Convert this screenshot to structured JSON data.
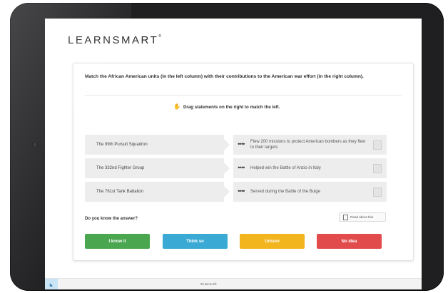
{
  "brand": {
    "name": "LEARNSMART",
    "mark": "®"
  },
  "question": {
    "text": "Match the African American units (in the left column) with their contributions to the American war effort (in the right column).",
    "instruction": "Drag statements on the right to match the left."
  },
  "match_pairs": [
    {
      "left": "The 99th Pursuit Squadron",
      "right": "Flew 200 missions to protect American bombers as they flew to their targets"
    },
    {
      "left": "The 332nd Fighter Group",
      "right": "Helped win the Battle of Anzio in Italy"
    },
    {
      "left": "The 761st Tank Battalion",
      "right": "Served during the Battle of the Bulge"
    }
  ],
  "confidence": {
    "prompt": "Do you know the answer?",
    "read_about": "Read about this",
    "buttons": [
      "I know it",
      "Think so",
      "Unsure",
      "No idea"
    ]
  },
  "footer": {
    "progress": "00 items left",
    "tab_glyph": "◣"
  },
  "colors": {
    "know": "#4aa64f",
    "think": "#3aaad4",
    "unsure": "#f2b51e",
    "no_idea": "#e24b4b"
  }
}
